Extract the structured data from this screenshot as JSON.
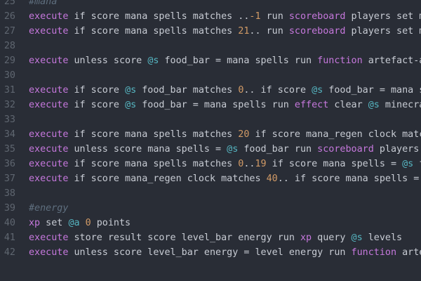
{
  "theme": {
    "background": "#292d36",
    "line_number": "#5f6670",
    "text": "#c8ccd4",
    "keyword": "#c678dd",
    "selector": "#56b6c2",
    "number": "#d19a66",
    "comment": "#5f6f7f"
  },
  "lines": [
    {
      "n": "25",
      "tokens": [
        {
          "t": "cmt",
          "v": "#mana"
        }
      ]
    },
    {
      "n": "26",
      "tokens": [
        {
          "t": "kw",
          "v": "execute"
        },
        {
          "t": "txt",
          "v": " if score mana spells matches .."
        },
        {
          "t": "num",
          "v": "-1"
        },
        {
          "t": "txt",
          "v": " run "
        },
        {
          "t": "kw",
          "v": "scoreboard"
        },
        {
          "t": "txt",
          "v": " players set mana"
        }
      ]
    },
    {
      "n": "27",
      "tokens": [
        {
          "t": "kw",
          "v": "execute"
        },
        {
          "t": "txt",
          "v": " if score mana spells matches "
        },
        {
          "t": "num",
          "v": "21"
        },
        {
          "t": "txt",
          "v": ".. run "
        },
        {
          "t": "kw",
          "v": "scoreboard"
        },
        {
          "t": "txt",
          "v": " players set mana"
        }
      ]
    },
    {
      "n": "28",
      "tokens": []
    },
    {
      "n": "29",
      "tokens": [
        {
          "t": "kw",
          "v": "execute"
        },
        {
          "t": "txt",
          "v": " unless score "
        },
        {
          "t": "sel",
          "v": "@s"
        },
        {
          "t": "txt",
          "v": " food_bar = mana spells run "
        },
        {
          "t": "kw",
          "v": "function"
        },
        {
          "t": "txt",
          "v": " artefact-api:"
        }
      ]
    },
    {
      "n": "30",
      "tokens": []
    },
    {
      "n": "31",
      "tokens": [
        {
          "t": "kw",
          "v": "execute"
        },
        {
          "t": "txt",
          "v": " if score "
        },
        {
          "t": "sel",
          "v": "@s"
        },
        {
          "t": "txt",
          "v": " food_bar matches "
        },
        {
          "t": "num",
          "v": "0"
        },
        {
          "t": "txt",
          "v": ".. if score "
        },
        {
          "t": "sel",
          "v": "@s"
        },
        {
          "t": "txt",
          "v": " food_bar = mana spel"
        }
      ]
    },
    {
      "n": "32",
      "tokens": [
        {
          "t": "kw",
          "v": "execute"
        },
        {
          "t": "txt",
          "v": " if score "
        },
        {
          "t": "sel",
          "v": "@s"
        },
        {
          "t": "txt",
          "v": " food_bar = mana spells run "
        },
        {
          "t": "kw",
          "v": "effect"
        },
        {
          "t": "txt",
          "v": " clear "
        },
        {
          "t": "sel",
          "v": "@s"
        },
        {
          "t": "txt",
          "v": " minecraft:"
        }
      ]
    },
    {
      "n": "33",
      "tokens": []
    },
    {
      "n": "34",
      "tokens": [
        {
          "t": "kw",
          "v": "execute"
        },
        {
          "t": "txt",
          "v": " if score mana spells matches "
        },
        {
          "t": "num",
          "v": "20"
        },
        {
          "t": "txt",
          "v": " if score mana_regen clock matches"
        }
      ]
    },
    {
      "n": "35",
      "tokens": [
        {
          "t": "kw",
          "v": "execute"
        },
        {
          "t": "txt",
          "v": " unless score mana spells = "
        },
        {
          "t": "sel",
          "v": "@s"
        },
        {
          "t": "txt",
          "v": " food_bar run "
        },
        {
          "t": "kw",
          "v": "scoreboard"
        },
        {
          "t": "txt",
          "v": " players set"
        }
      ]
    },
    {
      "n": "36",
      "tokens": [
        {
          "t": "kw",
          "v": "execute"
        },
        {
          "t": "txt",
          "v": " if score mana spells matches "
        },
        {
          "t": "num",
          "v": "0"
        },
        {
          "t": "txt",
          "v": ".."
        },
        {
          "t": "num",
          "v": "19"
        },
        {
          "t": "txt",
          "v": " if score mana spells = "
        },
        {
          "t": "sel",
          "v": "@s"
        },
        {
          "t": "txt",
          "v": " food"
        }
      ]
    },
    {
      "n": "37",
      "tokens": [
        {
          "t": "kw",
          "v": "execute"
        },
        {
          "t": "txt",
          "v": " if score mana_regen clock matches "
        },
        {
          "t": "num",
          "v": "40"
        },
        {
          "t": "txt",
          "v": ".. if score mana spells = "
        },
        {
          "t": "sel",
          "v": "@s"
        }
      ]
    },
    {
      "n": "38",
      "tokens": []
    },
    {
      "n": "39",
      "tokens": [
        {
          "t": "cmt",
          "v": "#energy"
        }
      ]
    },
    {
      "n": "40",
      "tokens": [
        {
          "t": "kw",
          "v": "xp"
        },
        {
          "t": "txt",
          "v": " set "
        },
        {
          "t": "sel",
          "v": "@a"
        },
        {
          "t": "txt",
          "v": " "
        },
        {
          "t": "num",
          "v": "0"
        },
        {
          "t": "txt",
          "v": " points"
        }
      ]
    },
    {
      "n": "41",
      "tokens": [
        {
          "t": "kw",
          "v": "execute"
        },
        {
          "t": "txt",
          "v": " store result score level_bar energy run "
        },
        {
          "t": "kw",
          "v": "xp"
        },
        {
          "t": "txt",
          "v": " query "
        },
        {
          "t": "sel",
          "v": "@s"
        },
        {
          "t": "txt",
          "v": " levels"
        }
      ]
    },
    {
      "n": "42",
      "tokens": [
        {
          "t": "kw",
          "v": "execute"
        },
        {
          "t": "txt",
          "v": " unless score level_bar energy = level energy run "
        },
        {
          "t": "kw",
          "v": "function"
        },
        {
          "t": "txt",
          "v": " artefac"
        }
      ]
    }
  ]
}
